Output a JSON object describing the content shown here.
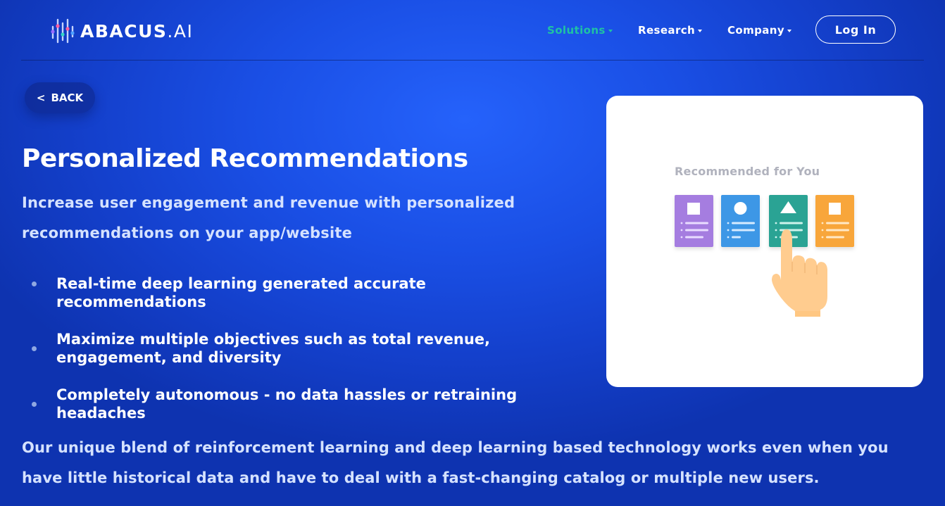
{
  "brand": {
    "name_strong": "ABACUS",
    "name_light": ".AI"
  },
  "nav": {
    "items": [
      {
        "label": "Solutions",
        "active": true
      },
      {
        "label": "Research",
        "active": false
      },
      {
        "label": "Company",
        "active": false
      }
    ],
    "login_label": "Log In"
  },
  "back": {
    "arrow": "<",
    "label": "BACK"
  },
  "hero": {
    "title": "Personalized Recommendations",
    "subtitle": "Increase user engagement and revenue with personalized recommendations on your app/website"
  },
  "features": [
    "Real-time deep learning generated accurate recommendations",
    "Maximize multiple objectives such as total revenue, engagement, and diversity",
    "Completely autonomous - no data hassles or retraining headaches"
  ],
  "closing": "Our unique blend of reinforcement learning and deep learning based technology works even when you have little historical data and have to deal with a fast-changing catalog or multiple new users.",
  "illustration": {
    "label": "Recommended for You",
    "cards": [
      {
        "shape": "square",
        "color": "#a57de0"
      },
      {
        "shape": "circle",
        "color": "#3c97e6"
      },
      {
        "shape": "triangle",
        "color": "#2ba394"
      },
      {
        "shape": "square",
        "color": "#f8a63a"
      }
    ],
    "hand_icon": "pointing-hand-icon"
  },
  "colors": {
    "background": "#1a4fe5",
    "accent_active_nav": "#1fc2a4",
    "card_background": "#ffffff"
  }
}
